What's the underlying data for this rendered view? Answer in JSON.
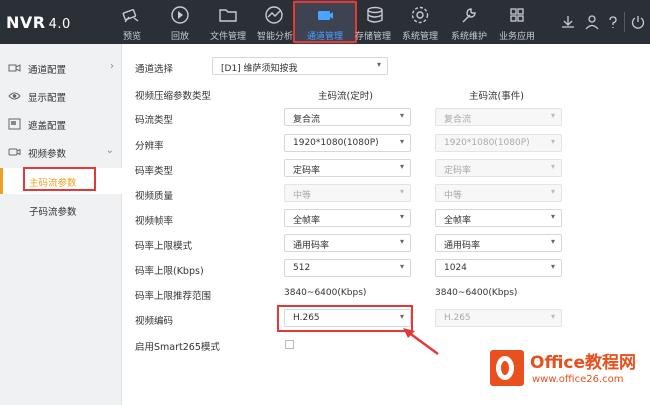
{
  "app": {
    "logo": "NVR",
    "version": "4.0"
  },
  "nav": [
    {
      "label": "预览",
      "icon": "camera-icon"
    },
    {
      "label": "回放",
      "icon": "playback-icon"
    },
    {
      "label": "文件管理",
      "icon": "folder-icon"
    },
    {
      "label": "智能分析",
      "icon": "analytics-icon"
    },
    {
      "label": "通道管理",
      "icon": "channel-icon"
    },
    {
      "label": "存储管理",
      "icon": "storage-icon"
    },
    {
      "label": "系统管理",
      "icon": "gear-icon"
    },
    {
      "label": "系统维护",
      "icon": "wrench-icon"
    },
    {
      "label": "业务应用",
      "icon": "apps-icon"
    }
  ],
  "sidebar": {
    "items": [
      {
        "label": "通道配置",
        "icon": "channel-config-icon",
        "arrow": "›"
      },
      {
        "label": "显示配置",
        "icon": "eye-icon"
      },
      {
        "label": "遮盖配置",
        "icon": "mask-icon"
      },
      {
        "label": "视频参数",
        "icon": "video-icon",
        "arrow": "⌄"
      }
    ],
    "sub_items": [
      {
        "label": "主码流参数"
      },
      {
        "label": "子码流参数"
      }
    ]
  },
  "form": {
    "channel_label": "通道选择",
    "channel_value": "[D1] 维萨须知按我",
    "param_type_label": "视频压缩参数类型",
    "col_main": "主码流(定时)",
    "col_event": "主码流(事件)",
    "rows": [
      {
        "label": "码流类型",
        "main": "复合流",
        "event": "复合流"
      },
      {
        "label": "分辨率",
        "main": "1920*1080(1080P)",
        "event": "1920*1080(1080P)"
      },
      {
        "label": "码率类型",
        "main": "定码率",
        "event": "定码率"
      },
      {
        "label": "视频质量",
        "main": "中等",
        "event": "中等"
      },
      {
        "label": "视频帧率",
        "main": "全帧率",
        "event": "全帧率"
      },
      {
        "label": "码率上限模式",
        "main": "通用码率",
        "event": "通用码率"
      },
      {
        "label": "码率上限(Kbps)",
        "main": "512",
        "event": "1024"
      }
    ],
    "range_label": "码率上限推荐范围",
    "range_main": "3840~6400(Kbps)",
    "range_event": "3840~6400(Kbps)",
    "codec_label": "视频编码",
    "codec_main": "H.265",
    "codec_event": "H.265",
    "smart_label": "启用Smart265模式"
  },
  "watermark": {
    "title": "Office教程网",
    "url": "www.office26.com"
  }
}
